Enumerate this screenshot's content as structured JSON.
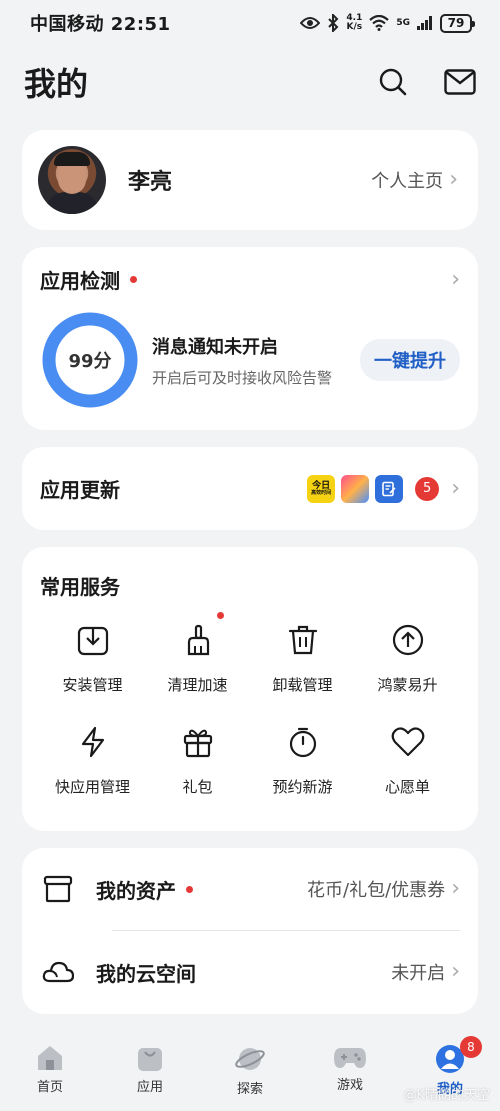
{
  "status_bar": {
    "carrier_time": "中国移动 22:51",
    "net_speed": "4.1\nK/s",
    "signal_type": "5G",
    "battery": "79"
  },
  "header": {
    "title": "我的"
  },
  "profile": {
    "name": "李亮",
    "link_label": "个人主页"
  },
  "app_detection": {
    "title": "应用检测",
    "score": "99分",
    "score_value": 99,
    "main_text": "消息通知未开启",
    "sub_text": "开启后可及时接收风险告警",
    "action_label": "一键提升"
  },
  "app_update": {
    "title": "应用更新",
    "thumb1_text": "今日",
    "thumb1_sub": "高效时间",
    "count": "5"
  },
  "services": {
    "title": "常用服务",
    "items": [
      {
        "label": "安装管理",
        "icon": "install-icon"
      },
      {
        "label": "清理加速",
        "icon": "broom-icon"
      },
      {
        "label": "卸载管理",
        "icon": "trash-icon"
      },
      {
        "label": "鸿蒙易升",
        "icon": "arrow-up-circle-icon"
      },
      {
        "label": "快应用管理",
        "icon": "lightning-icon"
      },
      {
        "label": "礼包",
        "icon": "gift-icon"
      },
      {
        "label": "预约新游",
        "icon": "stopwatch-icon"
      },
      {
        "label": "心愿单",
        "icon": "heart-icon"
      }
    ]
  },
  "assets": {
    "rows": [
      {
        "label": "我的资产",
        "value": "花币/礼包/优惠券",
        "icon": "box-icon"
      },
      {
        "label": "我的云空间",
        "value": "未开启",
        "icon": "cloud-icon"
      }
    ]
  },
  "tabbar": {
    "items": [
      {
        "label": "首页",
        "icon": "home-icon"
      },
      {
        "label": "应用",
        "icon": "bag-icon"
      },
      {
        "label": "探索",
        "icon": "planet-icon"
      },
      {
        "label": "游戏",
        "icon": "gamepad-icon"
      },
      {
        "label": "我的",
        "icon": "user-icon"
      }
    ],
    "me_badge": "8"
  },
  "watermark": "@K晴朗的天空",
  "colors": {
    "accent": "#1f5fc6",
    "ring": "#4a8df2",
    "alert": "#e53935"
  }
}
